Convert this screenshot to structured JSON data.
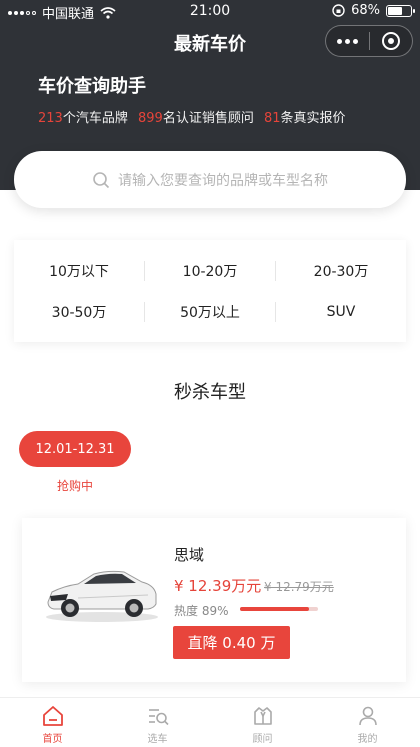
{
  "status_bar": {
    "carrier": "中国联通",
    "time": "21:00",
    "battery": "68%",
    "battery_level": 0.68
  },
  "nav": {
    "title": "最新车价"
  },
  "hero": {
    "title": "车价查询助手",
    "brands_count": "213",
    "brands_text": "个汽车品牌",
    "consultants_count": "899",
    "consultants_text": "名认证销售顾问",
    "quotes_count": "81",
    "quotes_text": "条真实报价"
  },
  "search": {
    "placeholder": "请输入您要查询的品牌或车型名称"
  },
  "price_filters": [
    "10万以下",
    "10-20万",
    "20-30万",
    "30-50万",
    "50万以上",
    "SUV"
  ],
  "flash_sale": {
    "section_title": "秒杀车型",
    "period": "12.01-12.31",
    "status": "抢购中",
    "car": {
      "name": "思域",
      "price": "¥ 12.39万元",
      "original_price": "¥ 12.79万元",
      "heat_label": "热度 89%",
      "heat_value": 0.89,
      "cut_label": "直降 0.40 万"
    }
  },
  "tabbar": {
    "items": [
      {
        "label": "首页",
        "icon": "home-icon",
        "active": true
      },
      {
        "label": "选车",
        "icon": "car-search-icon",
        "active": false
      },
      {
        "label": "顾问",
        "icon": "consultant-icon",
        "active": false
      },
      {
        "label": "我的",
        "icon": "user-icon",
        "active": false
      }
    ]
  },
  "colors": {
    "header_bg": "#2f3237",
    "accent": "#e8453c"
  }
}
